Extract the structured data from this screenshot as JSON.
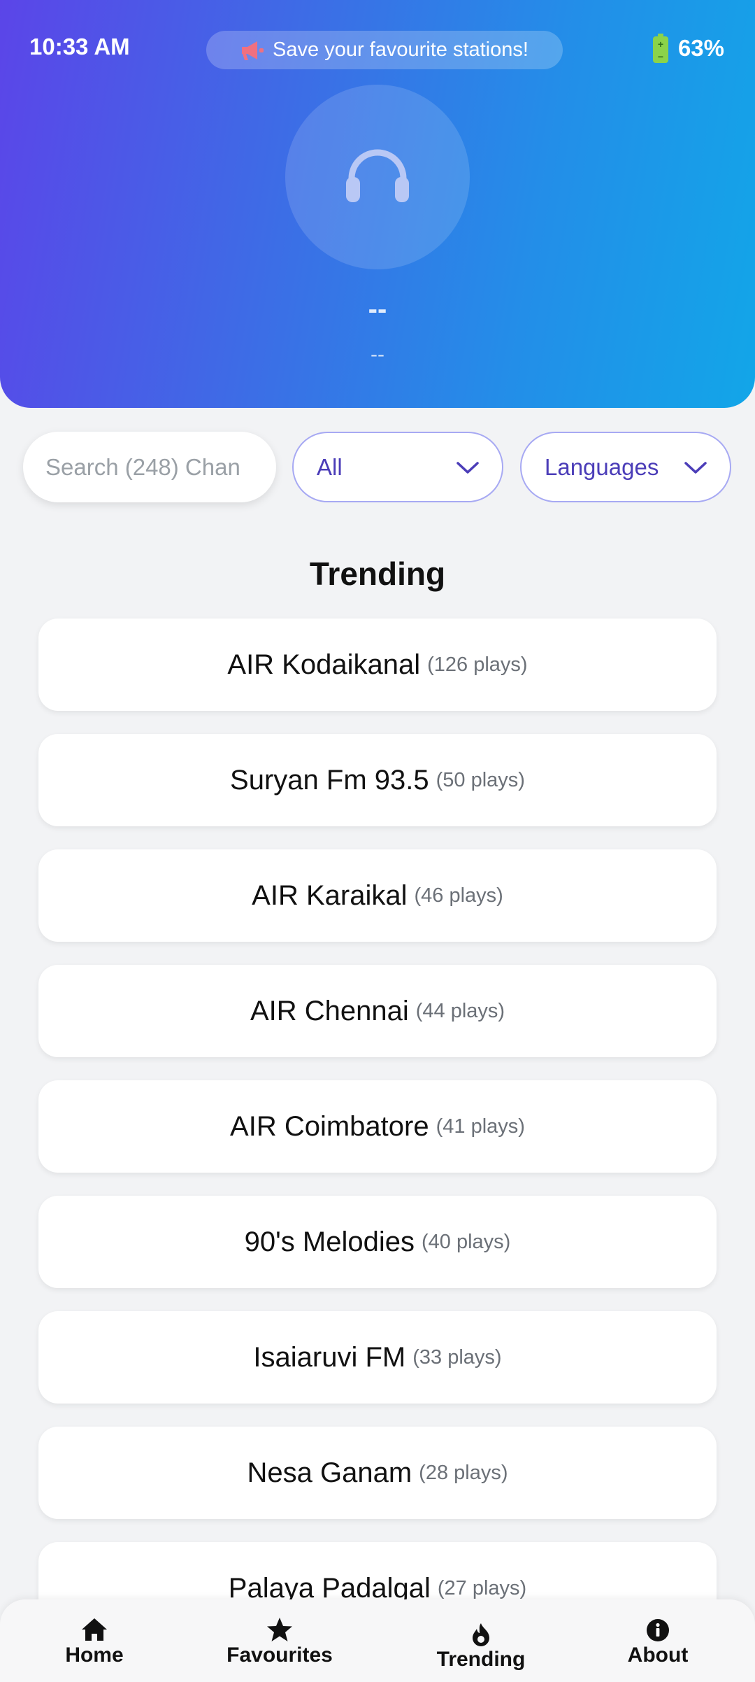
{
  "status": {
    "time": "10:33 AM",
    "battery": "63%"
  },
  "promo": {
    "text": "Save your favourite stations!",
    "icon": "megaphone-icon"
  },
  "now_playing": {
    "icon": "headphones-icon",
    "title": "--",
    "subtitle": "--"
  },
  "controls": {
    "search_placeholder": "Search (248) Chan",
    "category_selected": "All",
    "language_selected": "Languages"
  },
  "section_title": "Trending",
  "stations": [
    {
      "name": "AIR Kodaikanal",
      "plays": "(126 plays)"
    },
    {
      "name": "Suryan Fm 93.5",
      "plays": "(50 plays)"
    },
    {
      "name": "AIR Karaikal",
      "plays": "(46 plays)"
    },
    {
      "name": "AIR Chennai",
      "plays": "(44 plays)"
    },
    {
      "name": "AIR Coimbatore",
      "plays": "(41 plays)"
    },
    {
      "name": "90's Melodies",
      "plays": "(40 plays)"
    },
    {
      "name": "Isaiaruvi FM",
      "plays": "(33 plays)"
    },
    {
      "name": "Nesa Ganam",
      "plays": "(28 plays)"
    },
    {
      "name": "Palaya Padalgal",
      "plays": "(27 plays)"
    }
  ],
  "nav": [
    {
      "label": "Home",
      "icon": "home-icon"
    },
    {
      "label": "Favourites",
      "icon": "star-icon"
    },
    {
      "label": "Trending",
      "icon": "flame-icon"
    },
    {
      "label": "About",
      "icon": "info-icon"
    }
  ],
  "colors": {
    "header_gradient_start": "#5b45e8",
    "header_gradient_end": "#12a6e8",
    "accent": "#4b3db8",
    "select_border": "#a7a9f3",
    "battery": "#8bd34a"
  }
}
